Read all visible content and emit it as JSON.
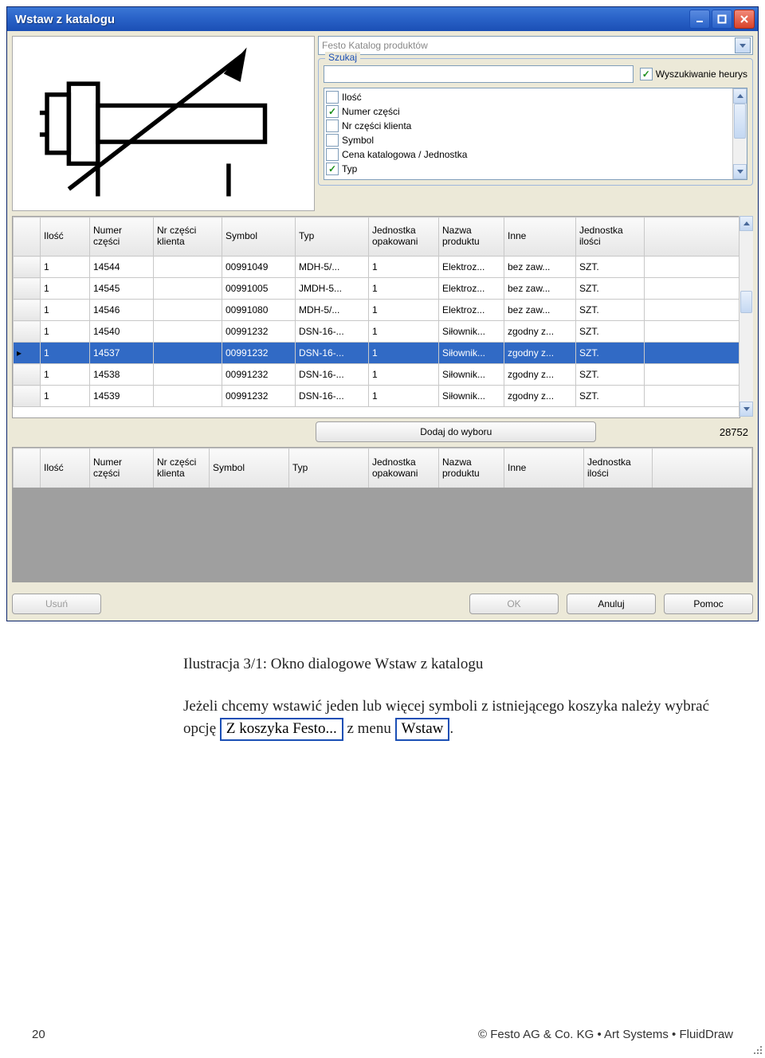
{
  "window": {
    "title": "Wstaw z katalogu"
  },
  "catalog_combo": "Festo Katalog produktów",
  "search": {
    "legend": "Szukaj",
    "heuristic_label": "Wyszukiwanie heurys",
    "heuristic_checked": true,
    "value": ""
  },
  "checklist": [
    {
      "label": "Ilość",
      "checked": false
    },
    {
      "label": "Numer części",
      "checked": true
    },
    {
      "label": "Nr części klienta",
      "checked": false
    },
    {
      "label": "Symbol",
      "checked": false
    },
    {
      "label": "Cena katalogowa / Jednostka",
      "checked": false
    },
    {
      "label": "Typ",
      "checked": true
    }
  ],
  "grid1": {
    "headers": [
      "",
      "Ilość",
      "Numer części",
      "Nr części klienta",
      "Symbol",
      "Typ",
      "Jednostka opakowani",
      "Nazwa produktu",
      "Inne",
      "Jednostka ilości"
    ],
    "selected_index": 4,
    "rows": [
      [
        "1",
        "14544",
        "",
        "00991049",
        "MDH-5/...",
        "1",
        "Elektroz...",
        "bez zaw...",
        "SZT."
      ],
      [
        "1",
        "14545",
        "",
        "00991005",
        "JMDH-5...",
        "1",
        "Elektroz...",
        "bez zaw...",
        "SZT."
      ],
      [
        "1",
        "14546",
        "",
        "00991080",
        "MDH-5/...",
        "1",
        "Elektroz...",
        "bez zaw...",
        "SZT."
      ],
      [
        "1",
        "14540",
        "",
        "00991232",
        "DSN-16-...",
        "1",
        "Siłownik...",
        "zgodny z...",
        "SZT."
      ],
      [
        "1",
        "14537",
        "",
        "00991232",
        "DSN-16-...",
        "1",
        "Siłownik...",
        "zgodny z...",
        "SZT."
      ],
      [
        "1",
        "14538",
        "",
        "00991232",
        "DSN-16-...",
        "1",
        "Siłownik...",
        "zgodny z...",
        "SZT."
      ],
      [
        "1",
        "14539",
        "",
        "00991232",
        "DSN-16-...",
        "1",
        "Siłownik...",
        "zgodny z...",
        "SZT."
      ]
    ]
  },
  "add_button": "Dodaj do wyboru",
  "count": "28752",
  "grid2": {
    "headers": [
      "",
      "Ilość",
      "Numer części",
      "Nr części klienta",
      "Symbol",
      "Typ",
      "Jednostka opakowani",
      "Nazwa produktu",
      "Inne",
      "Jednostka ilości"
    ]
  },
  "buttons": {
    "remove": "Usuń",
    "ok": "OK",
    "cancel": "Anuluj",
    "help": "Pomoc"
  },
  "doc": {
    "caption": "Ilustracja 3/1: Okno dialogowe Wstaw z katalogu",
    "para_pre": "Jeżeli chcemy wstawić jeden lub więcej symboli z istniejącego koszyka należy wybrać opcję ",
    "menu1": "Z koszyka Festo...",
    "para_mid": " z menu ",
    "menu2": "Wstaw",
    "para_post": "."
  },
  "footer": {
    "page": "20",
    "text": "© Festo AG & Co. KG • Art Systems • FluidDraw"
  }
}
